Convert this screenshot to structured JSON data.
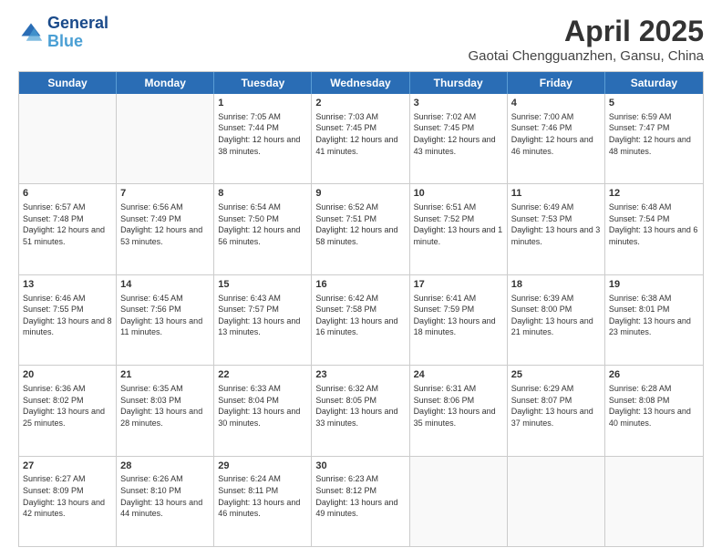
{
  "header": {
    "logo_line1": "General",
    "logo_line2": "Blue",
    "title": "April 2025",
    "subtitle": "Gaotai Chengguanzhen, Gansu, China"
  },
  "days_of_week": [
    "Sunday",
    "Monday",
    "Tuesday",
    "Wednesday",
    "Thursday",
    "Friday",
    "Saturday"
  ],
  "weeks": [
    [
      {
        "day": "",
        "info": ""
      },
      {
        "day": "",
        "info": ""
      },
      {
        "day": "1",
        "info": "Sunrise: 7:05 AM\nSunset: 7:44 PM\nDaylight: 12 hours and 38 minutes."
      },
      {
        "day": "2",
        "info": "Sunrise: 7:03 AM\nSunset: 7:45 PM\nDaylight: 12 hours and 41 minutes."
      },
      {
        "day": "3",
        "info": "Sunrise: 7:02 AM\nSunset: 7:45 PM\nDaylight: 12 hours and 43 minutes."
      },
      {
        "day": "4",
        "info": "Sunrise: 7:00 AM\nSunset: 7:46 PM\nDaylight: 12 hours and 46 minutes."
      },
      {
        "day": "5",
        "info": "Sunrise: 6:59 AM\nSunset: 7:47 PM\nDaylight: 12 hours and 48 minutes."
      }
    ],
    [
      {
        "day": "6",
        "info": "Sunrise: 6:57 AM\nSunset: 7:48 PM\nDaylight: 12 hours and 51 minutes."
      },
      {
        "day": "7",
        "info": "Sunrise: 6:56 AM\nSunset: 7:49 PM\nDaylight: 12 hours and 53 minutes."
      },
      {
        "day": "8",
        "info": "Sunrise: 6:54 AM\nSunset: 7:50 PM\nDaylight: 12 hours and 56 minutes."
      },
      {
        "day": "9",
        "info": "Sunrise: 6:52 AM\nSunset: 7:51 PM\nDaylight: 12 hours and 58 minutes."
      },
      {
        "day": "10",
        "info": "Sunrise: 6:51 AM\nSunset: 7:52 PM\nDaylight: 13 hours and 1 minute."
      },
      {
        "day": "11",
        "info": "Sunrise: 6:49 AM\nSunset: 7:53 PM\nDaylight: 13 hours and 3 minutes."
      },
      {
        "day": "12",
        "info": "Sunrise: 6:48 AM\nSunset: 7:54 PM\nDaylight: 13 hours and 6 minutes."
      }
    ],
    [
      {
        "day": "13",
        "info": "Sunrise: 6:46 AM\nSunset: 7:55 PM\nDaylight: 13 hours and 8 minutes."
      },
      {
        "day": "14",
        "info": "Sunrise: 6:45 AM\nSunset: 7:56 PM\nDaylight: 13 hours and 11 minutes."
      },
      {
        "day": "15",
        "info": "Sunrise: 6:43 AM\nSunset: 7:57 PM\nDaylight: 13 hours and 13 minutes."
      },
      {
        "day": "16",
        "info": "Sunrise: 6:42 AM\nSunset: 7:58 PM\nDaylight: 13 hours and 16 minutes."
      },
      {
        "day": "17",
        "info": "Sunrise: 6:41 AM\nSunset: 7:59 PM\nDaylight: 13 hours and 18 minutes."
      },
      {
        "day": "18",
        "info": "Sunrise: 6:39 AM\nSunset: 8:00 PM\nDaylight: 13 hours and 21 minutes."
      },
      {
        "day": "19",
        "info": "Sunrise: 6:38 AM\nSunset: 8:01 PM\nDaylight: 13 hours and 23 minutes."
      }
    ],
    [
      {
        "day": "20",
        "info": "Sunrise: 6:36 AM\nSunset: 8:02 PM\nDaylight: 13 hours and 25 minutes."
      },
      {
        "day": "21",
        "info": "Sunrise: 6:35 AM\nSunset: 8:03 PM\nDaylight: 13 hours and 28 minutes."
      },
      {
        "day": "22",
        "info": "Sunrise: 6:33 AM\nSunset: 8:04 PM\nDaylight: 13 hours and 30 minutes."
      },
      {
        "day": "23",
        "info": "Sunrise: 6:32 AM\nSunset: 8:05 PM\nDaylight: 13 hours and 33 minutes."
      },
      {
        "day": "24",
        "info": "Sunrise: 6:31 AM\nSunset: 8:06 PM\nDaylight: 13 hours and 35 minutes."
      },
      {
        "day": "25",
        "info": "Sunrise: 6:29 AM\nSunset: 8:07 PM\nDaylight: 13 hours and 37 minutes."
      },
      {
        "day": "26",
        "info": "Sunrise: 6:28 AM\nSunset: 8:08 PM\nDaylight: 13 hours and 40 minutes."
      }
    ],
    [
      {
        "day": "27",
        "info": "Sunrise: 6:27 AM\nSunset: 8:09 PM\nDaylight: 13 hours and 42 minutes."
      },
      {
        "day": "28",
        "info": "Sunrise: 6:26 AM\nSunset: 8:10 PM\nDaylight: 13 hours and 44 minutes."
      },
      {
        "day": "29",
        "info": "Sunrise: 6:24 AM\nSunset: 8:11 PM\nDaylight: 13 hours and 46 minutes."
      },
      {
        "day": "30",
        "info": "Sunrise: 6:23 AM\nSunset: 8:12 PM\nDaylight: 13 hours and 49 minutes."
      },
      {
        "day": "",
        "info": ""
      },
      {
        "day": "",
        "info": ""
      },
      {
        "day": "",
        "info": ""
      }
    ]
  ]
}
